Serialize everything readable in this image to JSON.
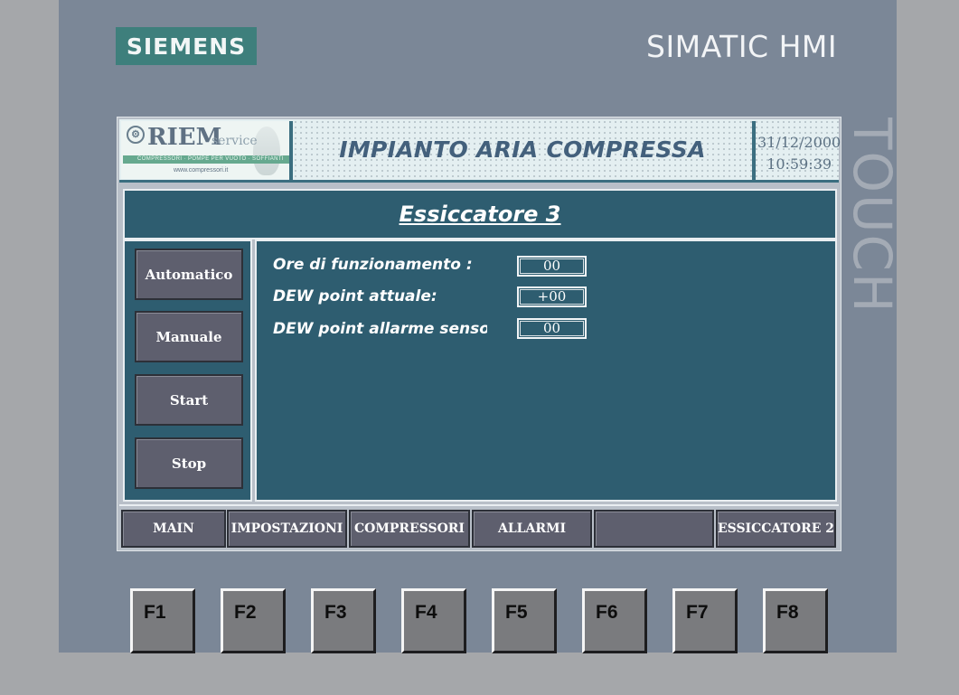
{
  "device": {
    "brand": "SIEMENS",
    "product": "SIMATIC HMI",
    "touch_label": "TOUCH"
  },
  "header": {
    "company_logo_name": "RIEM",
    "company_logo_service": "service",
    "company_tagline": "COMPRESSORI · POMPE PER VUOTO · SOFFIANTI",
    "company_url": "www.compressori.it",
    "plant_title": "IMPIANTO ARIA COMPRESSA",
    "date": "31/12/2000",
    "time": "10:59:39"
  },
  "page_title": "Essiccatore 3",
  "side_buttons": [
    {
      "label": "Automatico"
    },
    {
      "label": "Manuale"
    },
    {
      "label": "Start"
    },
    {
      "label": "Stop"
    }
  ],
  "fields": [
    {
      "label": "Ore di funzionamento :",
      "value": "00"
    },
    {
      "label": "DEW point attuale:",
      "value": "+00"
    },
    {
      "label": "DEW point allarme senso",
      "value": "00"
    }
  ],
  "nav_buttons": [
    {
      "label": "MAIN"
    },
    {
      "label": "IMPOSTAZIONI"
    },
    {
      "label": "COMPRESSORI"
    },
    {
      "label": "ALLARMI"
    },
    {
      "label": ""
    },
    {
      "label": "ESSICCATORE 2"
    }
  ],
  "function_keys": [
    "F1",
    "F2",
    "F3",
    "F4",
    "F5",
    "F6",
    "F7",
    "F8"
  ],
  "colors": {
    "bezel": "#7b8797",
    "brand_logo": "#3e7f7c",
    "panel": "#2e5d70",
    "button": "#5e5f6e"
  }
}
